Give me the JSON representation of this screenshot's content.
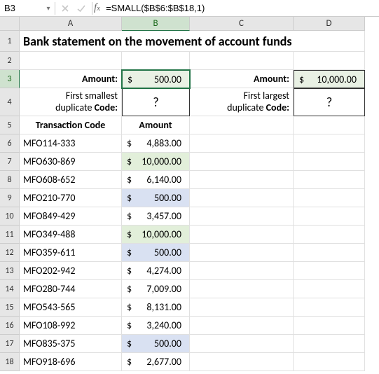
{
  "namebox": "B3",
  "formula": "=SMALL($B$6:$B$18,1)",
  "columns": [
    "A",
    "B",
    "C",
    "D"
  ],
  "rows": [
    "1",
    "2",
    "3",
    "4",
    "5",
    "6",
    "7",
    "8",
    "9",
    "10",
    "11",
    "12",
    "13",
    "14",
    "15",
    "16",
    "17",
    "18"
  ],
  "title": "Bank statement on the movement of account funds",
  "labels": {
    "amount": "Amount:",
    "first_smallest_l1": "First smallest",
    "first_largest_l1": "First largest",
    "duplicate_code_l2_pre": "duplicate ",
    "duplicate_code_l2_bold": "Code:",
    "question": "?",
    "th_code": "Transaction Code",
    "th_amount": "Amount"
  },
  "b3": {
    "cur": "$",
    "val": "500.00"
  },
  "d3": {
    "cur": "$",
    "val": "10,000.00"
  },
  "tx": [
    {
      "code": "MFO114-333",
      "cur": "$",
      "val": "4,883.00",
      "hl": ""
    },
    {
      "code": "MFO630-869",
      "cur": "$",
      "val": "10,000.00",
      "hl": "g"
    },
    {
      "code": "MFO608-652",
      "cur": "$",
      "val": "6,140.00",
      "hl": ""
    },
    {
      "code": "MFO210-770",
      "cur": "$",
      "val": "500.00",
      "hl": "b"
    },
    {
      "code": "MFO849-429",
      "cur": "$",
      "val": "3,457.00",
      "hl": ""
    },
    {
      "code": "MFO349-488",
      "cur": "$",
      "val": "10,000.00",
      "hl": "g"
    },
    {
      "code": "MFO359-611",
      "cur": "$",
      "val": "500.00",
      "hl": "b"
    },
    {
      "code": "MFO202-942",
      "cur": "$",
      "val": "4,274.00",
      "hl": ""
    },
    {
      "code": "MFO280-744",
      "cur": "$",
      "val": "7,009.00",
      "hl": ""
    },
    {
      "code": "MFO543-565",
      "cur": "$",
      "val": "8,131.00",
      "hl": ""
    },
    {
      "code": "MFO108-992",
      "cur": "$",
      "val": "3,240.00",
      "hl": ""
    },
    {
      "code": "MFO835-375",
      "cur": "$",
      "val": "500.00",
      "hl": "b"
    },
    {
      "code": "MFO918-696",
      "cur": "$",
      "val": "2,677.00",
      "hl": ""
    }
  ]
}
